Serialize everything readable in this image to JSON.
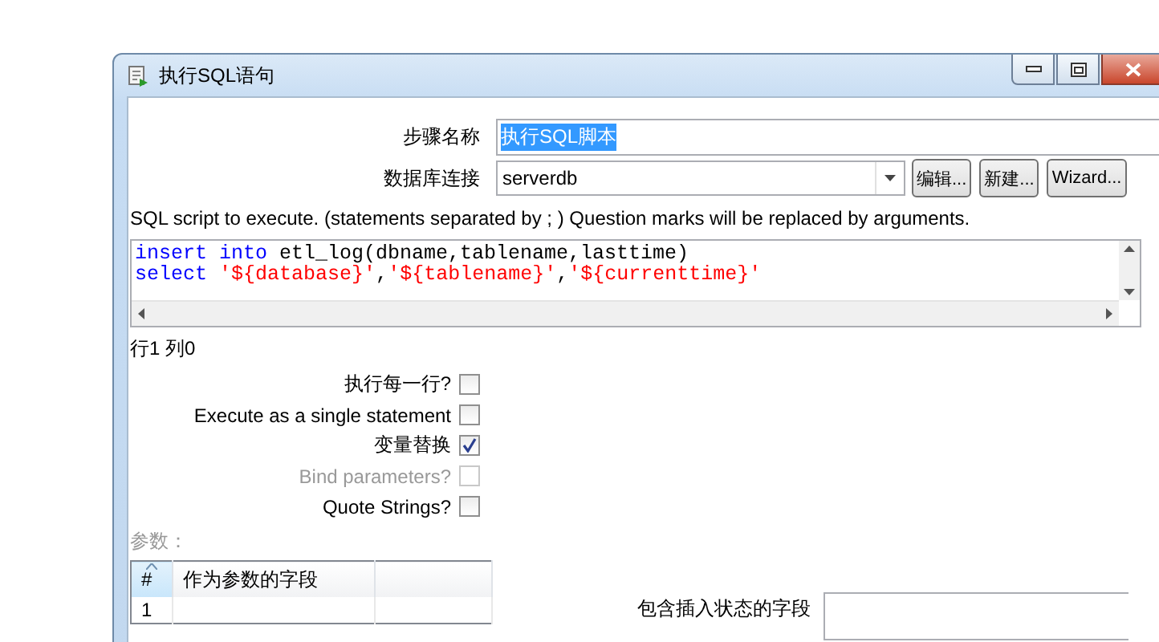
{
  "window": {
    "title": "执行SQL语句"
  },
  "step_name": {
    "label": "步骤名称",
    "value": "执行SQL脚本",
    "text_selected": true
  },
  "connection": {
    "label": "数据库连接",
    "value": "serverdb"
  },
  "connection_buttons": [
    "编辑...",
    "新建...",
    "Wizard..."
  ],
  "sql": {
    "label": "SQL script to execute. (statements separated by ; ) Question marks will be replaced by arguments.",
    "lines": [
      [
        {
          "kind": "keyword",
          "text": "insert into"
        },
        {
          "kind": "plain",
          "text": " etl_log(dbname,tablename,lasttime)"
        }
      ],
      [
        {
          "kind": "keyword",
          "text": "select"
        },
        {
          "kind": "string",
          "text": " '${database}'"
        },
        {
          "kind": "plain",
          "text": ","
        },
        {
          "kind": "string",
          "text": "'${tablename}'"
        },
        {
          "kind": "plain",
          "text": ","
        },
        {
          "kind": "string",
          "text": "'${currenttime}'"
        }
      ]
    ]
  },
  "cursor_position": "行1 列0",
  "options": [
    {
      "label": "执行每一行?",
      "checked": false,
      "disabled": false
    },
    {
      "label": "Execute as a single statement",
      "checked": false,
      "disabled": false
    },
    {
      "label": "变量替换",
      "checked": true,
      "disabled": false
    },
    {
      "label": "Bind parameters?",
      "checked": false,
      "disabled": true
    },
    {
      "label": "Quote Strings?",
      "checked": false,
      "disabled": false
    }
  ],
  "parameters": {
    "label": "参数：",
    "columns": [
      "#",
      "作为参数的字段"
    ],
    "rows": [
      {
        "cells": [
          "1"
        ]
      }
    ]
  },
  "insert_status_field": {
    "label": "包含插入状态的字段"
  }
}
